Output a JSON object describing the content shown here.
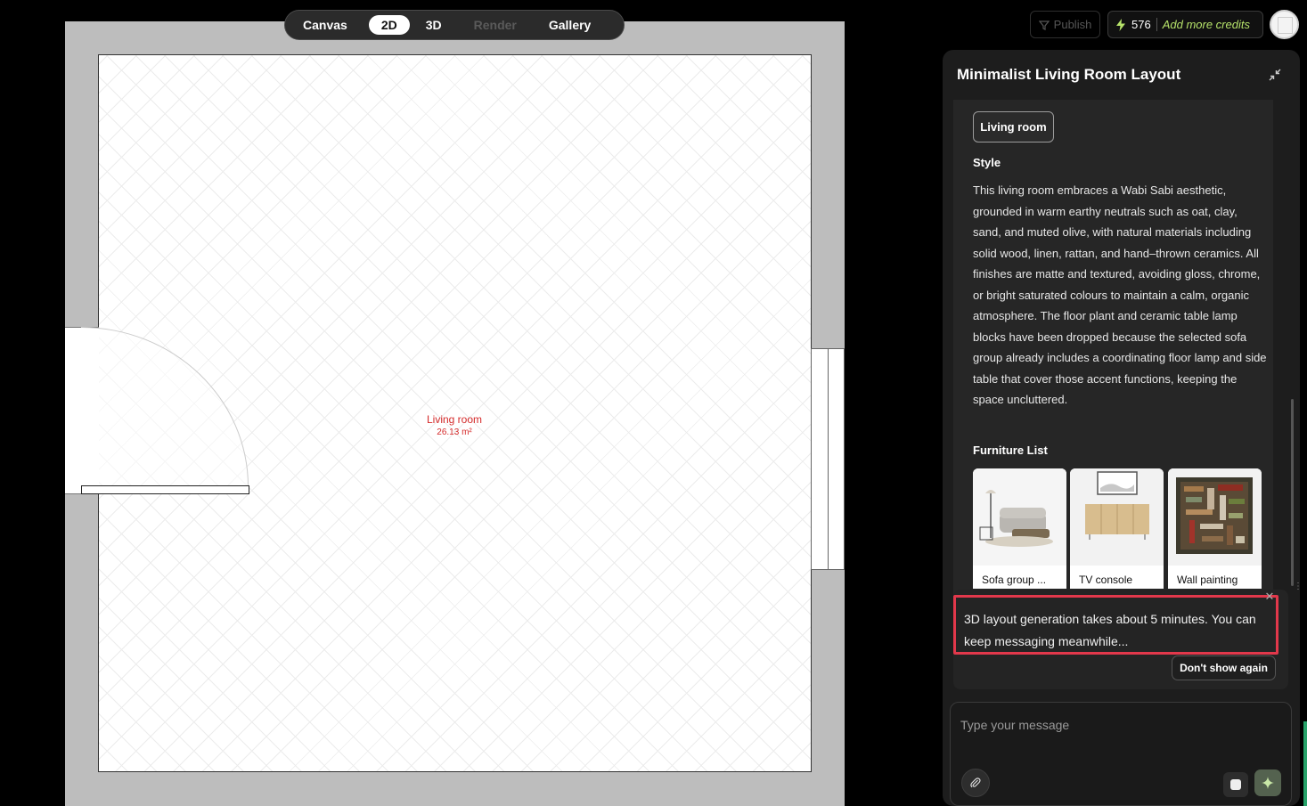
{
  "view_tabs": [
    {
      "label": "Canvas",
      "state": "normal"
    },
    {
      "label": "2D",
      "state": "active"
    },
    {
      "label": "3D",
      "state": "normal"
    },
    {
      "label": "Render",
      "state": "disabled"
    },
    {
      "label": "Gallery",
      "state": "normal"
    }
  ],
  "topbar": {
    "publish_label": "Publish",
    "credits_count": "576",
    "add_credits_label": "Add more credits"
  },
  "floorplan": {
    "room_name": "Living room",
    "room_area": "26.13 m²"
  },
  "panel": {
    "title": "Minimalist Living Room Layout",
    "room_chip": "Living room",
    "style_heading": "Style",
    "style_text": "This living room embraces a Wabi Sabi aesthetic, grounded in warm earthy neutrals such as oat, clay, sand, and muted olive, with natural materials including solid wood, linen, rattan, and hand–thrown ceramics. All finishes are matte and textured, avoiding gloss, chrome, or bright saturated colours to maintain a calm, organic atmosphere. The floor plant and ceramic table lamp blocks have been dropped because the selected sofa group already includes a coordinating floor lamp and side table that cover those accent functions, keeping the space uncluttered.",
    "furniture_heading": "Furniture List",
    "furniture": [
      {
        "label": "Sofa group ..."
      },
      {
        "label": "TV console"
      },
      {
        "label": "Wall painting"
      }
    ]
  },
  "notice": {
    "text": "3D layout generation takes about 5 minutes. You can keep messaging meanwhile...",
    "dont_show_label": "Don't show again"
  },
  "composer": {
    "placeholder": "Type your message"
  },
  "colors": {
    "room_label": "#d52b2b",
    "credits_accent": "#b6e36a",
    "notice_border": "#e2384b"
  }
}
